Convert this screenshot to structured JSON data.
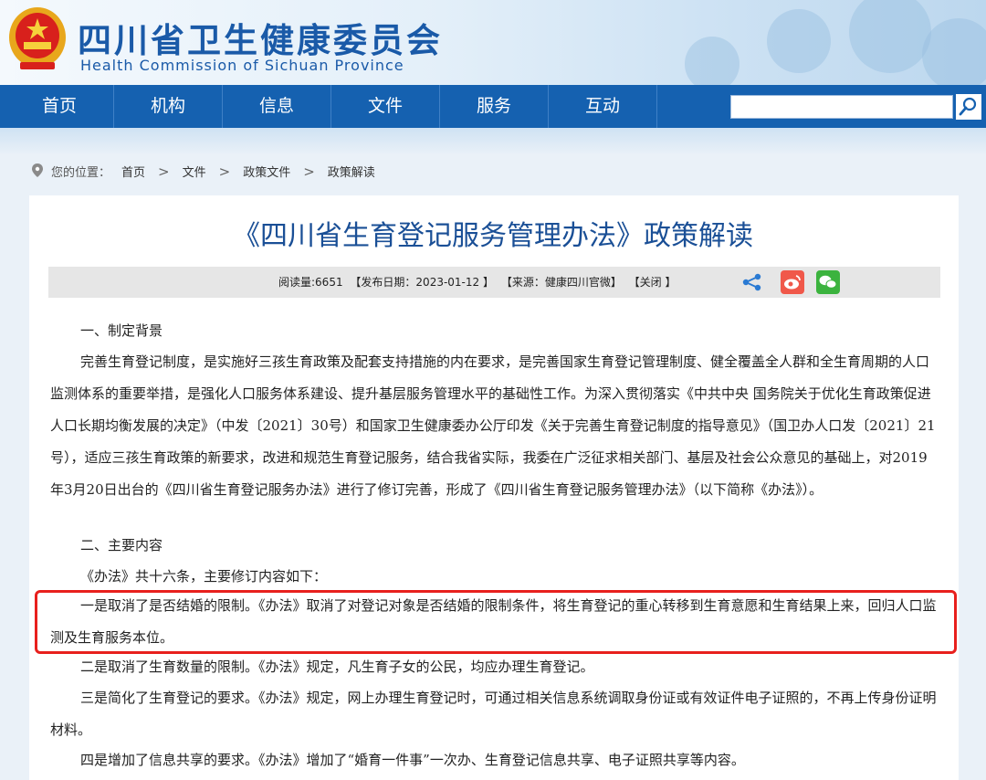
{
  "header": {
    "title": "四川省卫生健康委员会",
    "subtitle": "Health Commission of Sichuan Province"
  },
  "nav": {
    "items": [
      "首页",
      "机构",
      "信息",
      "文件",
      "服务",
      "互动"
    ],
    "search_placeholder": ""
  },
  "breadcrumb": {
    "label": "您的位置：",
    "items": [
      "首页",
      "文件",
      "政策文件",
      "政策解读"
    ]
  },
  "article": {
    "title": "《四川省生育登记服务管理办法》政策解读",
    "meta": {
      "read_label": "阅读量:6651",
      "date": "【发布日期：2023-01-12 】",
      "source": "【来源：健康四川官微】",
      "close": "【关闭 】"
    },
    "section1_heading": "一、制定背景",
    "section1_body": "完善生育登记制度，是实施好三孩生育政策及配套支持措施的内在要求，是完善国家生育登记管理制度、健全覆盖全人群和全生育周期的人口监测体系的重要举措，是强化人口服务体系建设、提升基层服务管理水平的基础性工作。为深入贯彻落实《中共中央 国务院关于优化生育政策促进人口长期均衡发展的决定》（中发〔2021〕30号）和国家卫生健康委办公厅印发《关于完善生育登记制度的指导意见》（国卫办人口发〔2021〕21号），适应三孩生育政策的新要求，改进和规范生育登记服务，结合我省实际，我委在广泛征求相关部门、基层及社会公众意见的基础上，对2019年3月20日出台的《四川省生育登记服务办法》进行了修订完善，形成了《四川省生育登记服务管理办法》（以下简称《办法》）。",
    "section2_heading": "二、主要内容",
    "section2_intro": "《办法》共十六条，主要修订内容如下：",
    "point1": "一是取消了是否结婚的限制。《办法》取消了对登记对象是否结婚的限制条件，将生育登记的重心转移到生育意愿和生育结果上来，回归人口监测及生育服务本位。",
    "point2": "二是取消了生育数量的限制。《办法》规定，凡生育子女的公民，均应办理生育登记。",
    "point3": "三是简化了生育登记的要求。《办法》规定，网上办理生育登记时，可通过相关信息系统调取身份证或有效证件电子证照的，不再上传身份证明材料。",
    "point4": "四是增加了信息共享的要求。《办法》增加了“婚育一件事”一次办、生育登记信息共享、电子证照共享等内容。"
  },
  "colors": {
    "nav_bg": "#1561b0",
    "title": "#1a4f96",
    "highlight_border": "#e8201d"
  }
}
